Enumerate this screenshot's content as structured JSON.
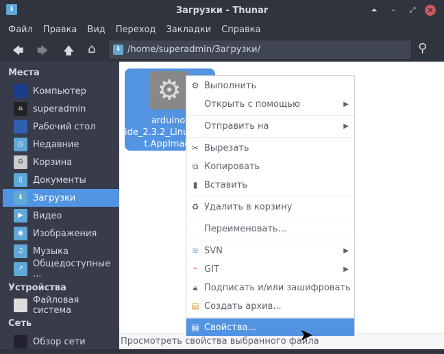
{
  "window": {
    "title": "Загрузки - Thunar"
  },
  "menubar": [
    "Файл",
    "Правка",
    "Вид",
    "Переход",
    "Закладки",
    "Справка"
  ],
  "path": "/home/superadmin/Загрузки/",
  "sidebar": {
    "places_header": "Места",
    "places": [
      "Компьютер",
      "superadmin",
      "Рабочий стол",
      "Недавние",
      "Корзина",
      "Документы",
      "Загрузки",
      "Видео",
      "Изображения",
      "Музыка",
      "Общедоступные ..."
    ],
    "devices_header": "Устройства",
    "devices": [
      "Файловая система"
    ],
    "network_header": "Сеть",
    "network": [
      "Обзор сети"
    ]
  },
  "file": {
    "name_lines": [
      "arduino-",
      "ide_2.3.2_Linux_64bi",
      "t.AppImage"
    ]
  },
  "context_menu": [
    "Выполнить",
    "Открыть с помощью",
    "Отправить на",
    "Вырезать",
    "Копировать",
    "Вставить",
    "Удалить в корзину",
    "Переименовать...",
    "SVN",
    "GIT",
    "Подписать и/или зашифровать",
    "Создать архив...",
    "Свойства..."
  ],
  "status": "Просмотреть свойства выбранного файла",
  "colors": {
    "accent": "#5294e2",
    "sidebar": "#383c4a",
    "titlebar": "#2f343f"
  }
}
